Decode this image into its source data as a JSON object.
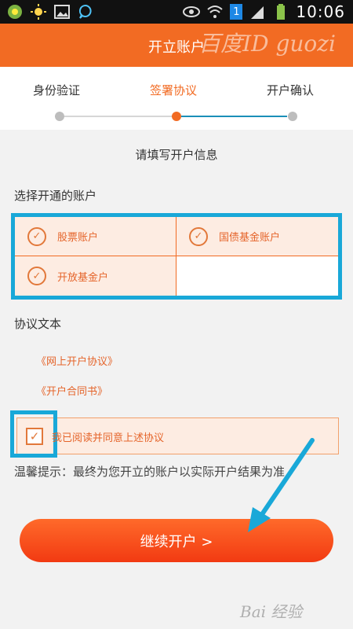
{
  "status_bar": {
    "time": "10:06",
    "sim_badge": "1"
  },
  "header": {
    "title": "开立账户",
    "watermark": "百度ID guozi"
  },
  "steps": [
    {
      "label": "身份验证",
      "active": false
    },
    {
      "label": "签署协议",
      "active": true
    },
    {
      "label": "开户确认",
      "active": false
    }
  ],
  "form": {
    "section_title": "请填写开户信息",
    "accounts_label": "选择开通的账户",
    "accounts": [
      {
        "name": "股票账户",
        "checked": true
      },
      {
        "name": "国债基金账户",
        "checked": true
      },
      {
        "name": "开放基金户",
        "checked": true
      }
    ],
    "agreement_label": "协议文本",
    "agreements": [
      "《网上开户协议》",
      "《开户合同书》"
    ],
    "agree_text": "我已阅读并同意上述协议",
    "agree_checked": true,
    "tip": "温馨提示：最终为您开立的账户以实际开户结果为准",
    "continue_label": "继续开户 >"
  },
  "footer": {
    "watermark": "Bai 经验"
  },
  "colors": {
    "accent": "#f26b23",
    "highlight": "#19a8d8"
  }
}
